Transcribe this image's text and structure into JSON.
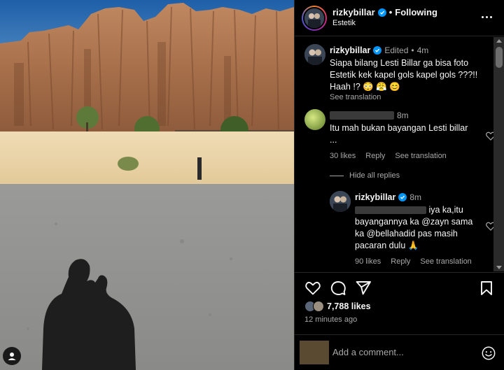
{
  "post": {
    "username": "rizkybillar",
    "separator": "•",
    "following_label": "Following",
    "location": "Estetik"
  },
  "caption": {
    "username": "rizkybillar",
    "edited_label": "Edited",
    "dot": "•",
    "time": "4m",
    "text": "Siapa bilang Lesti Billar ga bisa foto Estetik kek kapel gols kapel gols ???!! Haah !? 😳 😤 😊",
    "see_translation": "See translation"
  },
  "comment1": {
    "time": "8m",
    "text": "Itu mah bukan bayangan Lesti billar ...",
    "likes": "30 likes",
    "reply": "Reply",
    "see_translation": "See translation"
  },
  "hide_replies": "Hide all replies",
  "reply1": {
    "username": "rizkybillar",
    "time": "8m",
    "text": "iya ka,itu bayangannya ka @zayn sama ka @bellahadid pas masih pacaran dulu 🙏",
    "likes": "90 likes",
    "reply": "Reply",
    "see_translation": "See translation"
  },
  "post_meta": {
    "likes": "7,788 likes",
    "time_ago": "12 minutes ago"
  },
  "comment_box": {
    "placeholder": "Add a comment..."
  },
  "colors": {
    "background": "#000000",
    "verified": "#0095f6",
    "muted_text": "#a8a8a8",
    "divider": "#262626"
  },
  "icons": [
    "user-tag-icon",
    "more-options-icon",
    "verified-badge-icon",
    "heart-icon",
    "comment-icon",
    "share-icon",
    "bookmark-icon",
    "emoji-icon"
  ]
}
